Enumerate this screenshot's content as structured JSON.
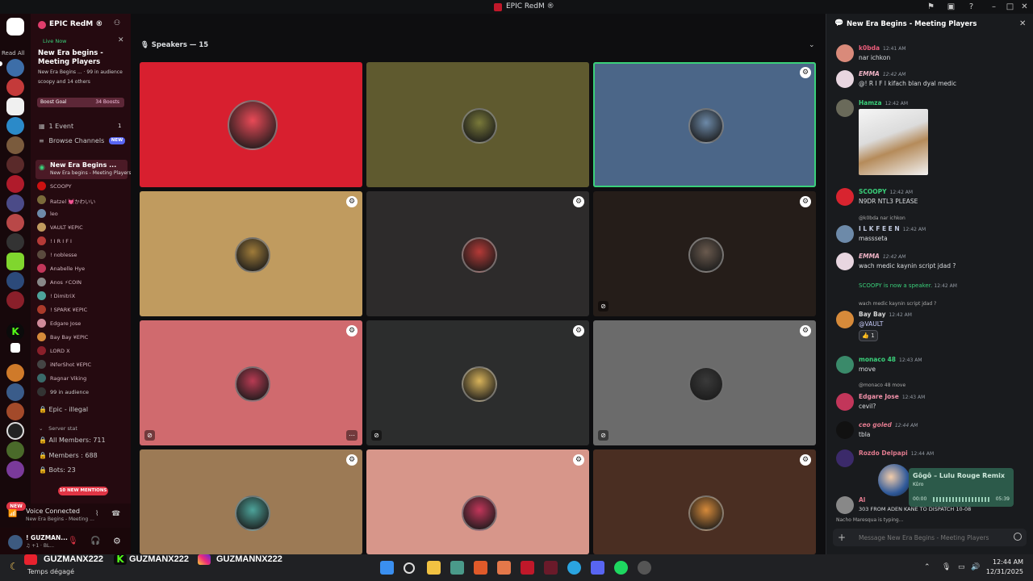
{
  "window": {
    "title": "EPIC RedM ®"
  },
  "rail": {
    "read_all": "Read All",
    "new": "NEW"
  },
  "server": {
    "name": "EPIC RedM ®",
    "live_now": "Live Now",
    "stage_title": "New Era begins - Meeting Players",
    "stage_channel": "New Era Begins ...",
    "audience": "99 in audience",
    "others": "scoopy and 14 others",
    "boost_goal": "Boost Goal",
    "boosts": "34 Boosts",
    "events": "1 Event",
    "events_count": "1",
    "browse_channels": "Browse Channels",
    "browse_badge": "NEW",
    "active_stage": "New Era Begins ...",
    "active_stage_sub": "New Era begins - Meeting Players",
    "speakers": [
      "SCOOPY",
      "Ratzel 💓かわいい",
      "leo",
      "VAULT ¥EPIC",
      "! I R I F I",
      "! noblesse",
      "Anabelle Hye",
      "Anos ⚡COIN",
      "! DimitriX",
      "! SPARK ¥EPIC",
      "Edgare Jose",
      "Bay Bay ¥EPIC",
      "LORD X",
      "iNferShot ¥EPIC",
      "Ragnar Viking"
    ],
    "speaker_audience": "99 in audience",
    "epic_illegal": "Epic - illegal",
    "server_stat": "Server stat",
    "all_members": "All Members: 711",
    "members": "Members : 688",
    "bots": "Bots: 23",
    "mentions": "10 NEW MENTIONS",
    "voice_connected": "Voice Connected",
    "voice_channel": "New Era Begins - Meeting ...",
    "user_name": "! GUZMAN...",
    "user_sub": "♫ +1 · BL..."
  },
  "stage": {
    "header": "Speakers — 15",
    "tiles": [
      {
        "bg": "#d81f2f",
        "ring": "#e94a57"
      },
      {
        "bg": "#5f5a2f",
        "ring": "#7a7a3a"
      },
      {
        "bg": "#4b6688",
        "ring": "#6d8aa9"
      },
      {
        "bg": "#c09b5f",
        "ring": "#a07c3a"
      },
      {
        "bg": "#2d2b2b",
        "ring": "#b53a37"
      },
      {
        "bg": "#251d19",
        "ring": "#6a5a4e"
      },
      {
        "bg": "#d06a6e",
        "ring": "#b83b53"
      },
      {
        "bg": "#2c2d2d",
        "ring": "#d8b35a"
      },
      {
        "bg": "#6b6b6b",
        "ring": "#3a3a3a"
      },
      {
        "bg": "#9c7a55",
        "ring": "#4da39a"
      },
      {
        "bg": "#d7968a",
        "ring": "#c2365a"
      },
      {
        "bg": "#4a2e22",
        "ring": "#d68a3a"
      }
    ]
  },
  "chat": {
    "title": "New Era Begins - Meeting Players",
    "messages": [
      {
        "name": "k0bda",
        "time": "12:41 AM",
        "text": "nar ichkon",
        "color": "#ec5d7b"
      },
      {
        "name": "EMMA",
        "time": "12:42 AM",
        "text": "@! R I F I kifach blan dyal medic",
        "color": "#f0b4c6"
      },
      {
        "name": "Hamza",
        "time": "12:42 AM",
        "text": "",
        "color": "#3ad07a"
      },
      {
        "name": "SCOOPY",
        "time": "12:42 AM",
        "text": "N9DR NTL3 PLEASE",
        "color": "#3ad07a"
      },
      {
        "name": "I L K F E E N",
        "time": "12:42 AM",
        "text": "massseta",
        "color": "#c3cbe0"
      },
      {
        "name": "EMMA",
        "time": "12:42 AM",
        "text": "wach medic kaynin script jdad ?",
        "color": "#f0b4c6"
      },
      {
        "name": "Bay Bay",
        "time": "12:42 AM",
        "text": "@VAULT",
        "color": "#d6d6d6"
      },
      {
        "name": "monaco 48",
        "time": "12:43 AM",
        "text": "move",
        "color": "#3ad07a"
      },
      {
        "name": "Edgare Jose",
        "time": "12:43 AM",
        "text": "cevil?",
        "color": "#f090a8"
      },
      {
        "name": "ceo goled",
        "time": "12:44 AM",
        "text": "tbla",
        "color": "#e07a8e"
      },
      {
        "name": "Rozdo Delpapi",
        "time": "12:44 AM",
        "text": "",
        "color": "#e07a8e"
      },
      {
        "name": "Al",
        "time": "",
        "text": "303 FROM ADEN KANE TO DISPATCH 10-08",
        "color": "#dbdee1"
      }
    ],
    "reply1": "@k0bda nar ichkon",
    "reply2": "wach medic kaynin script jdad ?",
    "reply3": "@monaco 48 move",
    "system": "SCOOPY is now a speaker.",
    "system_time": "12:42 AM",
    "reaction": "1",
    "typing": "Nacho Maresqua is typing...",
    "placeholder": "Message New Era Begins - Meeting Players"
  },
  "spotify": {
    "title": "Gôgô – Lulu Rouge Remix",
    "artist": "Kûro",
    "elapsed": "00:00",
    "duration": "05:39",
    "progress": 0.0
  },
  "overlay": {
    "youtube": "GUZMANX222",
    "kick": "GUZMANX222",
    "instagram": "GUZMANNX222"
  },
  "taskbar": {
    "weather": "Temps dégagé",
    "time": "12:44 AM",
    "date": "12/31/2025"
  }
}
